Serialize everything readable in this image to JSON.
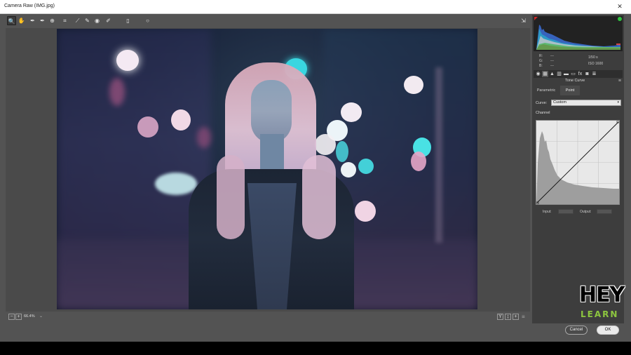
{
  "window": {
    "title": "Camera Raw (IMG.jpg)"
  },
  "toolbar": {
    "tools": [
      {
        "name": "zoom-tool",
        "glyph": "🔍"
      },
      {
        "name": "hand-tool",
        "glyph": "✋"
      },
      {
        "name": "white-balance-tool",
        "glyph": "✒"
      },
      {
        "name": "color-sampler-tool",
        "glyph": "✒"
      },
      {
        "name": "targeted-adjustment-tool",
        "glyph": "⊕"
      },
      {
        "name": "crop-tool",
        "glyph": "⌗"
      },
      {
        "name": "straighten-tool",
        "glyph": "⟋"
      },
      {
        "name": "spot-removal-tool",
        "glyph": "✎"
      },
      {
        "name": "red-eye-tool",
        "glyph": "◉"
      },
      {
        "name": "adjustment-brush-tool",
        "glyph": "✐"
      },
      {
        "name": "graduated-filter-tool",
        "glyph": "▯"
      },
      {
        "name": "radial-filter-tool",
        "glyph": "○"
      }
    ],
    "open_preferences_glyph": "⇲"
  },
  "statusbar": {
    "zoom": "66.4%"
  },
  "panel": {
    "readout": {
      "r_label": "R:",
      "r_value": "---",
      "g_label": "G:",
      "g_value": "---",
      "b_label": "B:",
      "b_value": "---",
      "shutter": "1/50 s",
      "iso": "ISO 1600"
    },
    "section_title": "Tone Curve",
    "subtabs": [
      "Parametric",
      "Point"
    ],
    "active_subtab": "Point",
    "curve_label": "Curve:",
    "curve_value": "Custom",
    "channel_label": "Channel",
    "input_label": "Input:",
    "output_label": "Output:"
  },
  "logo": {
    "top": "HEY",
    "bottom": "LEARN"
  },
  "buttons": {
    "cancel": "Cancel",
    "ok": "OK"
  },
  "colors": {
    "panel_bg": "#3d3d3d",
    "ui_bg": "#535353",
    "logo_green": "#8dc63f"
  }
}
